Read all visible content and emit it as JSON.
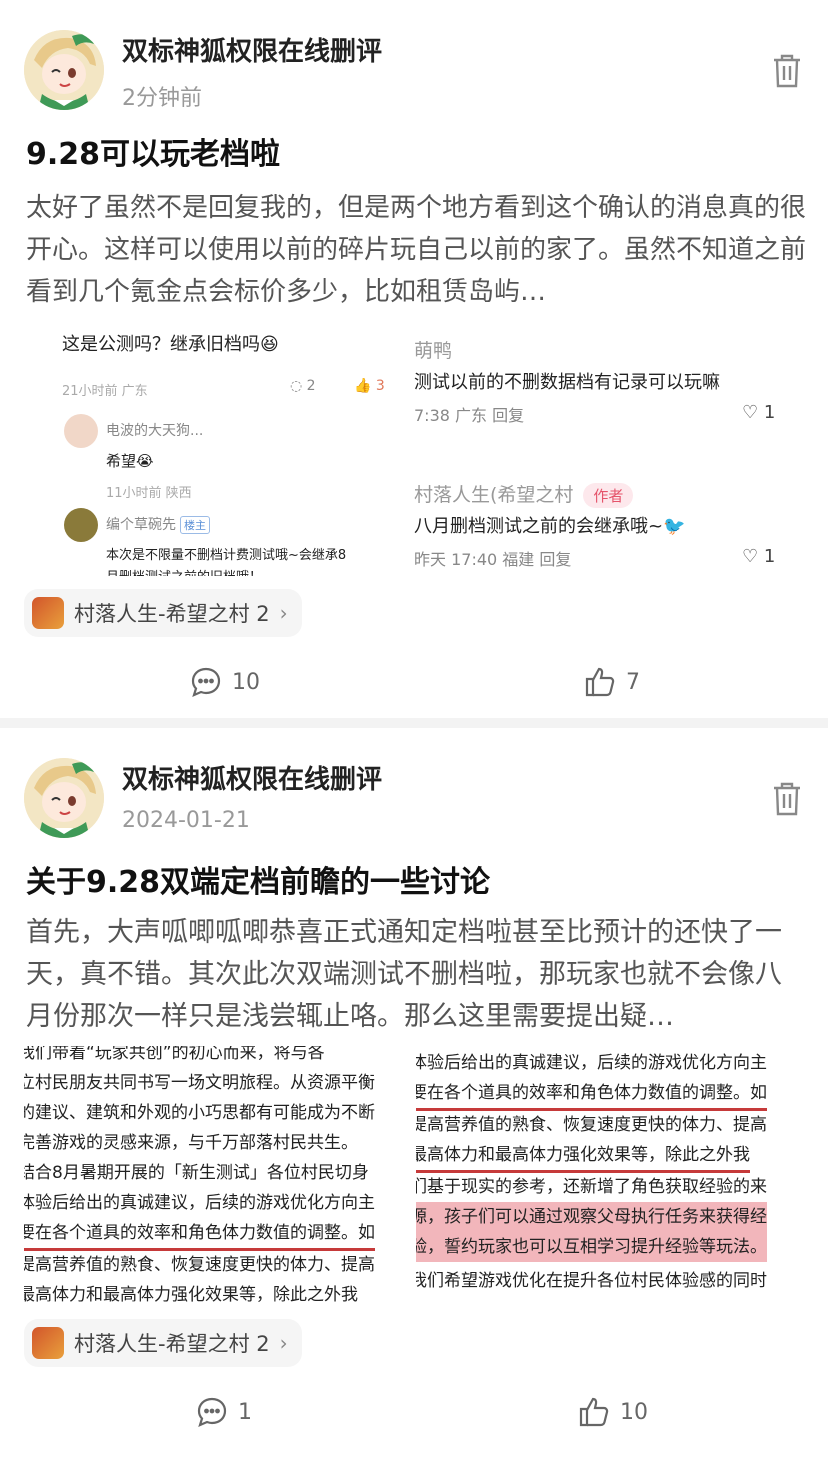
{
  "posts": [
    {
      "author": "双标神狐权限在线删评",
      "time": "2分钟前",
      "title": "9.28可以玩老档啦",
      "body": "太好了虽然不是回复我的，但是两个地方看到这个确认的消息真的很开心。这样可以使用以前的碎片玩自己以前的家了。虽然不知道之前看到几个氪金点会标价多少，比如租赁岛屿…",
      "left_shot": {
        "comment": "这是公测吗？继承旧档吗😆",
        "meta": "21小时前  广东",
        "comment_count": "2",
        "like_count": "3",
        "reply1_name": "电波的大天狗...",
        "reply1_text": "希望😭",
        "reply1_meta": "11小时前  陕西",
        "reply2_name": "编个草碗先",
        "reply2_badge": "楼主",
        "reply2_text": "本次是不限量不删档计费测试哦~会继承8",
        "reply2_text2": "月删档测试之前的旧档哦！"
      },
      "right_shot": {
        "name1": "萌鸭",
        "text1": "测试以前的不删数据档有记录可以玩嘛",
        "meta1": "7:38 广东  回复",
        "like1": "1",
        "name2": "村落人生(希望之村",
        "author_tag": "作者",
        "text2": "八月删档测试之前的会继承哦~🐦",
        "meta2": "昨天 17:40 福建  回复",
        "like2": "1"
      },
      "game_tag": "村落人生-希望之村 2",
      "comments": "10",
      "likes": "7"
    },
    {
      "author": "双标神狐权限在线删评",
      "time": "2024-01-21",
      "title": "关于9.28双端定档前瞻的一些讨论",
      "body": "首先，大声呱唧呱唧恭喜正式通知定档啦甚至比预计的还快了一天，真不错。其次此次双端测试不删档啦，那玩家也就不会像八月份那次一样只是浅尝辄止咯。那么这里需要提出疑…",
      "left_doc": [
        "我们带着“玩家共创”的初心而来，将与各",
        "立村民朋友共同书写一场文明旅程。从资源平衡",
        "的建议、建筑和外观的小巧思都有可能成为不断",
        "完善游戏的灵感来源，与千万部落村民共生。",
        "结合8月暑期开展的「新生测试」各位村民切身",
        "体验后给出的真诚建议，后续的游戏优化方向主",
        "要在各个道具的效率和角色体力数值的调整。如",
        "提高营养值的熟食、恢复速度更快的体力、提高",
        "最高体力和最高体力强化效果等，除此之外我"
      ],
      "right_doc": [
        "体验后给出的真诚建议，后续的游戏优化方向主",
        "要在各个道具的效率和角色体力数值的调整。如",
        "提高营养值的熟食、恢复速度更快的体力、提高",
        "最高体力和最高体力强化效果等，除此之外我",
        "们基于现实的参考，还新增了角色获取经验的来",
        "源，孩子们可以通过观察父母执行任务来获得经",
        "验，誓约玩家也可以互相学习提升经验等玩法。",
        "我们希望游戏优化在提升各位村民体验感的同时"
      ],
      "game_tag": "村落人生-希望之村 2",
      "comments": "1",
      "likes": "10"
    }
  ],
  "icons": {
    "trash": "trash-icon",
    "comment": "comment-bubble-icon",
    "like": "thumbs-up-icon",
    "chevron": "chevron-right-icon"
  },
  "colors": {
    "underline": "#c63a3a",
    "highlight": "#f2b6bb",
    "author_tag": "#e5546b"
  }
}
